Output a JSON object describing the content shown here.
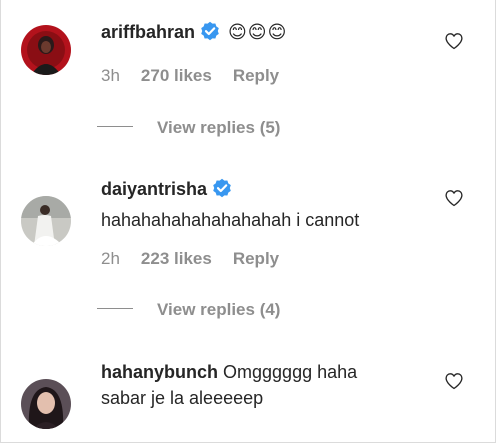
{
  "comments": [
    {
      "username": "ariffbahran",
      "text": "😊😊😊",
      "time": "3h",
      "likes": "270 likes",
      "reply_label": "Reply",
      "view_replies": "View replies (5)"
    },
    {
      "username": "daiyantrisha",
      "text": "hahahahahahahahahah i cannot",
      "time": "2h",
      "likes": "223 likes",
      "reply_label": "Reply",
      "view_replies": "View replies (4)"
    },
    {
      "username": "hahanybunch",
      "text_line1": "Omgggggg haha",
      "text_line2": "sabar je la aleeeeep"
    }
  ],
  "icons": {
    "verified": "verified-badge-icon",
    "heart": "heart-outline-icon"
  },
  "colors": {
    "verified_blue": "#3897f0",
    "muted_gray": "#8e8e8e",
    "text_dark": "#262626"
  }
}
